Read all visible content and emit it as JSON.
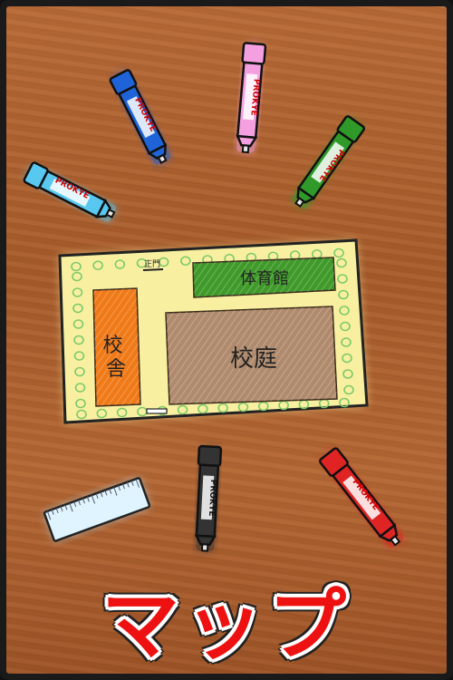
{
  "screen_title": "マップ",
  "map": {
    "gate_label": "正門",
    "gym_label": "体育館",
    "school_building_label": "校舎",
    "schoolyard_label": "校庭",
    "colors": {
      "paper": "#f8f0a0",
      "gym": "#3f9a2a",
      "school_building": "#f07a18",
      "schoolyard": "#b08a6c",
      "bushes": "#7cc86a"
    }
  },
  "markers": [
    {
      "name": "blue-marker",
      "brand": "PROKYE",
      "color": "#1e64d8"
    },
    {
      "name": "pink-marker",
      "brand": "PROKYE",
      "color": "#f4a0e0"
    },
    {
      "name": "green-marker",
      "brand": "PROKYE",
      "color": "#2f9a2a"
    },
    {
      "name": "light-blue-marker",
      "brand": "PROKYE",
      "color": "#58c8f0"
    },
    {
      "name": "black-marker",
      "brand": "PROKYE",
      "color": "#333333"
    },
    {
      "name": "red-marker",
      "brand": "PROKYE",
      "color": "#e02424"
    }
  ],
  "ruler": {
    "color": "#dff4ff"
  }
}
